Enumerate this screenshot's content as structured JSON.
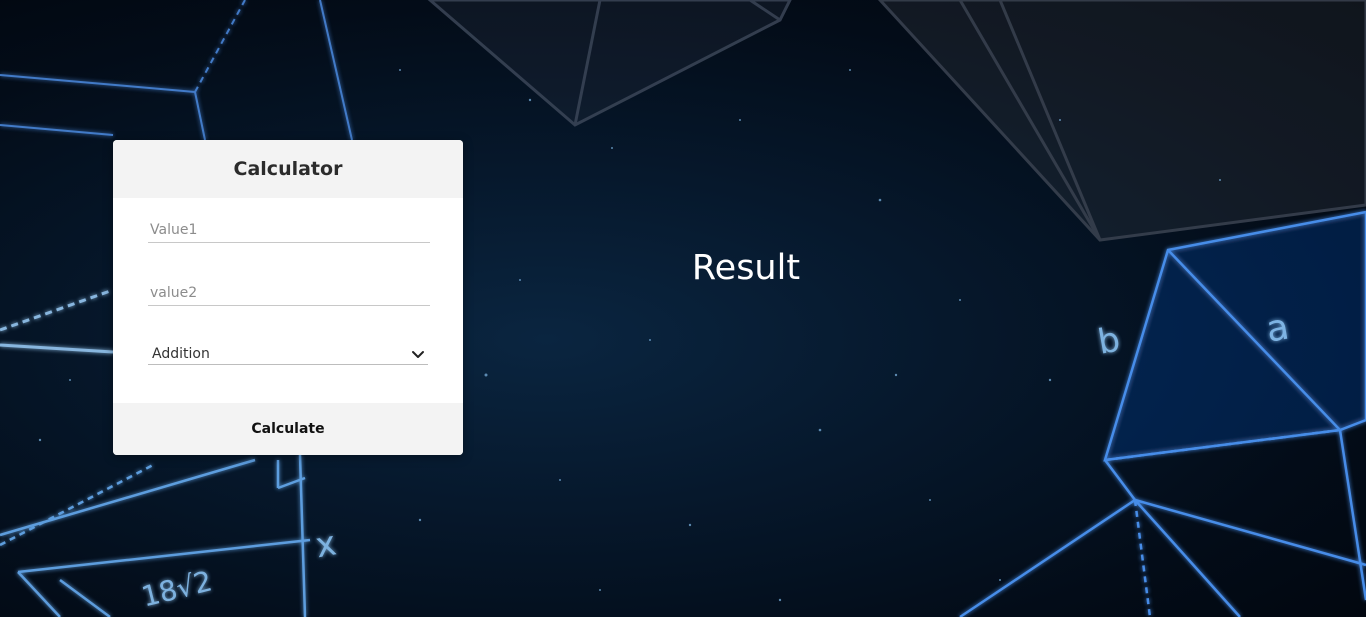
{
  "calculator": {
    "title": "Calculator",
    "value1_placeholder": "Value1",
    "value2_placeholder": "value2",
    "value1": "",
    "value2": "",
    "operation_selected": "Addition",
    "calculate_label": "Calculate"
  },
  "result": {
    "label": "Result"
  },
  "background": {
    "glyphs": [
      "b",
      "a",
      "18√2",
      "x"
    ]
  },
  "colors": {
    "card_header_bg": "#f3f3f3",
    "card_bg": "#ffffff",
    "result_text": "#ffffff",
    "line_glow": "#4a8fd8"
  }
}
